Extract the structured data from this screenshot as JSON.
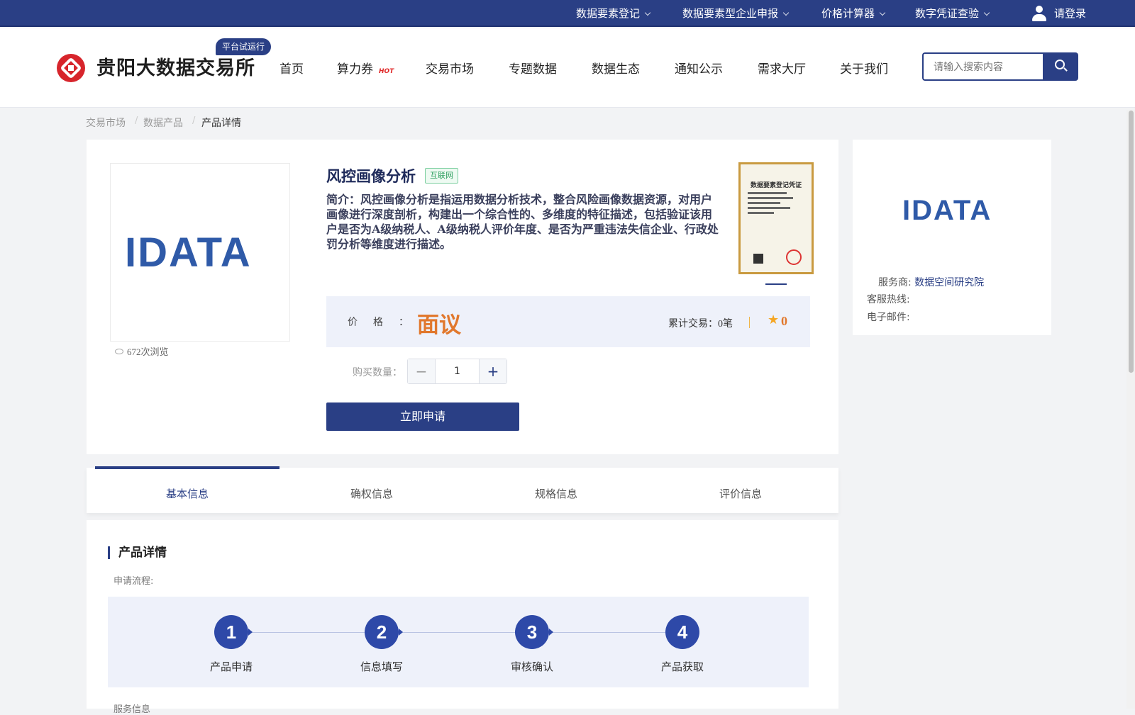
{
  "topbar": {
    "items": [
      {
        "label": "数据要素登记"
      },
      {
        "label": "数据要素型企业申报"
      },
      {
        "label": "价格计算器"
      },
      {
        "label": "数字凭证查验"
      }
    ],
    "login": "请登录"
  },
  "header": {
    "brand": "贵阳大数据交易所",
    "trial_badge": "平台试运行",
    "nav": [
      "首页",
      "算力券",
      "交易市场",
      "专题数据",
      "数据生态",
      "通知公示",
      "需求大厅",
      "关于我们"
    ],
    "hot_label": "HOT",
    "search_placeholder": "请输入搜索内容"
  },
  "breadcrumb": [
    "交易市场",
    "数据产品",
    "产品详情"
  ],
  "product": {
    "logo_text": "IDATA",
    "views": "672次浏览",
    "title": "风控画像分析",
    "tag": "互联网",
    "description": "简介：风控画像分析是指运用数据分析技术，整合风险画像数据资源，对用户画像进行深度剖析，构建出一个综合性的、多维度的特征描述，包括验证该用户是否为A级纳税人、A级纳税人评价年度、是否为严重违法失信企业、行政处罚分析等维度进行描述。",
    "certificate_title": "数据要素登记凭证",
    "price_label": "价格：",
    "price": "面议",
    "deals_label": "累计交易：",
    "deals": "0笔",
    "rating": "0",
    "quantity_label": "购买数量：",
    "quantity": "1",
    "apply_button": "立即申请"
  },
  "provider": {
    "logo_text": "IDATA",
    "service_label": "服务商:",
    "service_value": "数据空间研究院",
    "hotline_label": "客服热线:",
    "email_label": "电子邮件:"
  },
  "tabs": [
    "基本信息",
    "确权信息",
    "规格信息",
    "评价信息"
  ],
  "detail": {
    "title": "产品详情",
    "flow_label": "申请流程:",
    "steps": [
      {
        "num": "1",
        "name": "产品申请"
      },
      {
        "num": "2",
        "name": "信息填写"
      },
      {
        "num": "3",
        "name": "审核确认"
      },
      {
        "num": "4",
        "name": "产品获取"
      }
    ],
    "service_info_label": "服务信息"
  },
  "colors": {
    "primary": "#2a3f85",
    "accent_orange": "#e1782d",
    "brand_red": "#d7252c",
    "tag_green": "#2a9d5c"
  }
}
